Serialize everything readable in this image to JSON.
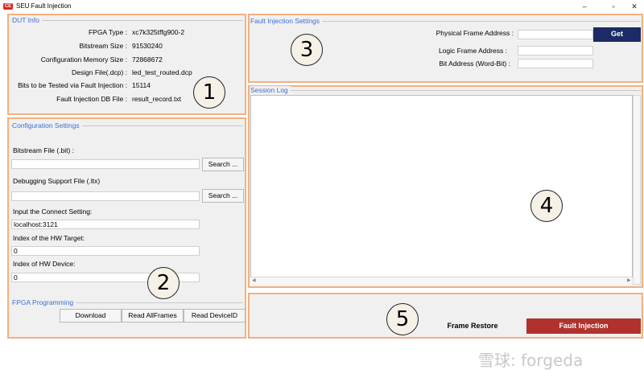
{
  "window": {
    "app_badge": "CE",
    "title": "SEU Fault Injection",
    "min_glyph": "–",
    "max_glyph": "▫",
    "close_glyph": "✕"
  },
  "dut_info": {
    "title": "DUT Info",
    "rows": [
      {
        "label": "FPGA Type :",
        "value": "xc7k325tffg900-2"
      },
      {
        "label": "Bitstream Size :",
        "value": "91530240"
      },
      {
        "label": "Configuration Memory Size :",
        "value": "72868672"
      },
      {
        "label": "Design File(.dcp) :",
        "value": "led_test_routed.dcp"
      },
      {
        "label": "Bits to be Tested via Fault Injection :",
        "value": "15114"
      },
      {
        "label": "Fault Injection DB File :",
        "value": "result_record.txt"
      }
    ],
    "badge": "1"
  },
  "config": {
    "title": "Configuration Settings",
    "bitstream_label": "Bitstream File (.bit) :",
    "bitstream_value": "",
    "debug_label": "Debugging Support File (.ltx)",
    "debug_value": "",
    "search_label": "Search ...",
    "connect_label": "Input the Connect Setting:",
    "connect_value": "localhost:3121",
    "hw_target_label": "Index of the HW Target:",
    "hw_target_value": "0",
    "hw_device_label": "Index of HW Device:",
    "hw_device_value": "0",
    "badge": "2"
  },
  "programming": {
    "title": "FPGA Programming",
    "download_label": "Download",
    "read_all_frames_label": "Read AllFrames",
    "read_device_id_label": "Read DeviceID"
  },
  "fault_settings": {
    "title": "Fault Injection Settings",
    "physical_label": "Physical Frame Address :",
    "physical_value": "",
    "logic_label": "Logic Frame Address :",
    "logic_value": "",
    "bit_label": "Bit Address (Word-Bit) :",
    "bit_value": "",
    "get_label": "Get",
    "badge": "3"
  },
  "session_log": {
    "title": "Session Log",
    "badge": "4"
  },
  "actions": {
    "frame_restore_label": "Frame Restore",
    "fault_injection_label": "Fault Injection",
    "badge": "5"
  },
  "watermark": "雪球: forgeda",
  "colors": {
    "panel_border": "#f3b07f",
    "title_blue": "#3e6fd0",
    "get_button": "#1c2a66",
    "fault_button": "#b1322d"
  }
}
